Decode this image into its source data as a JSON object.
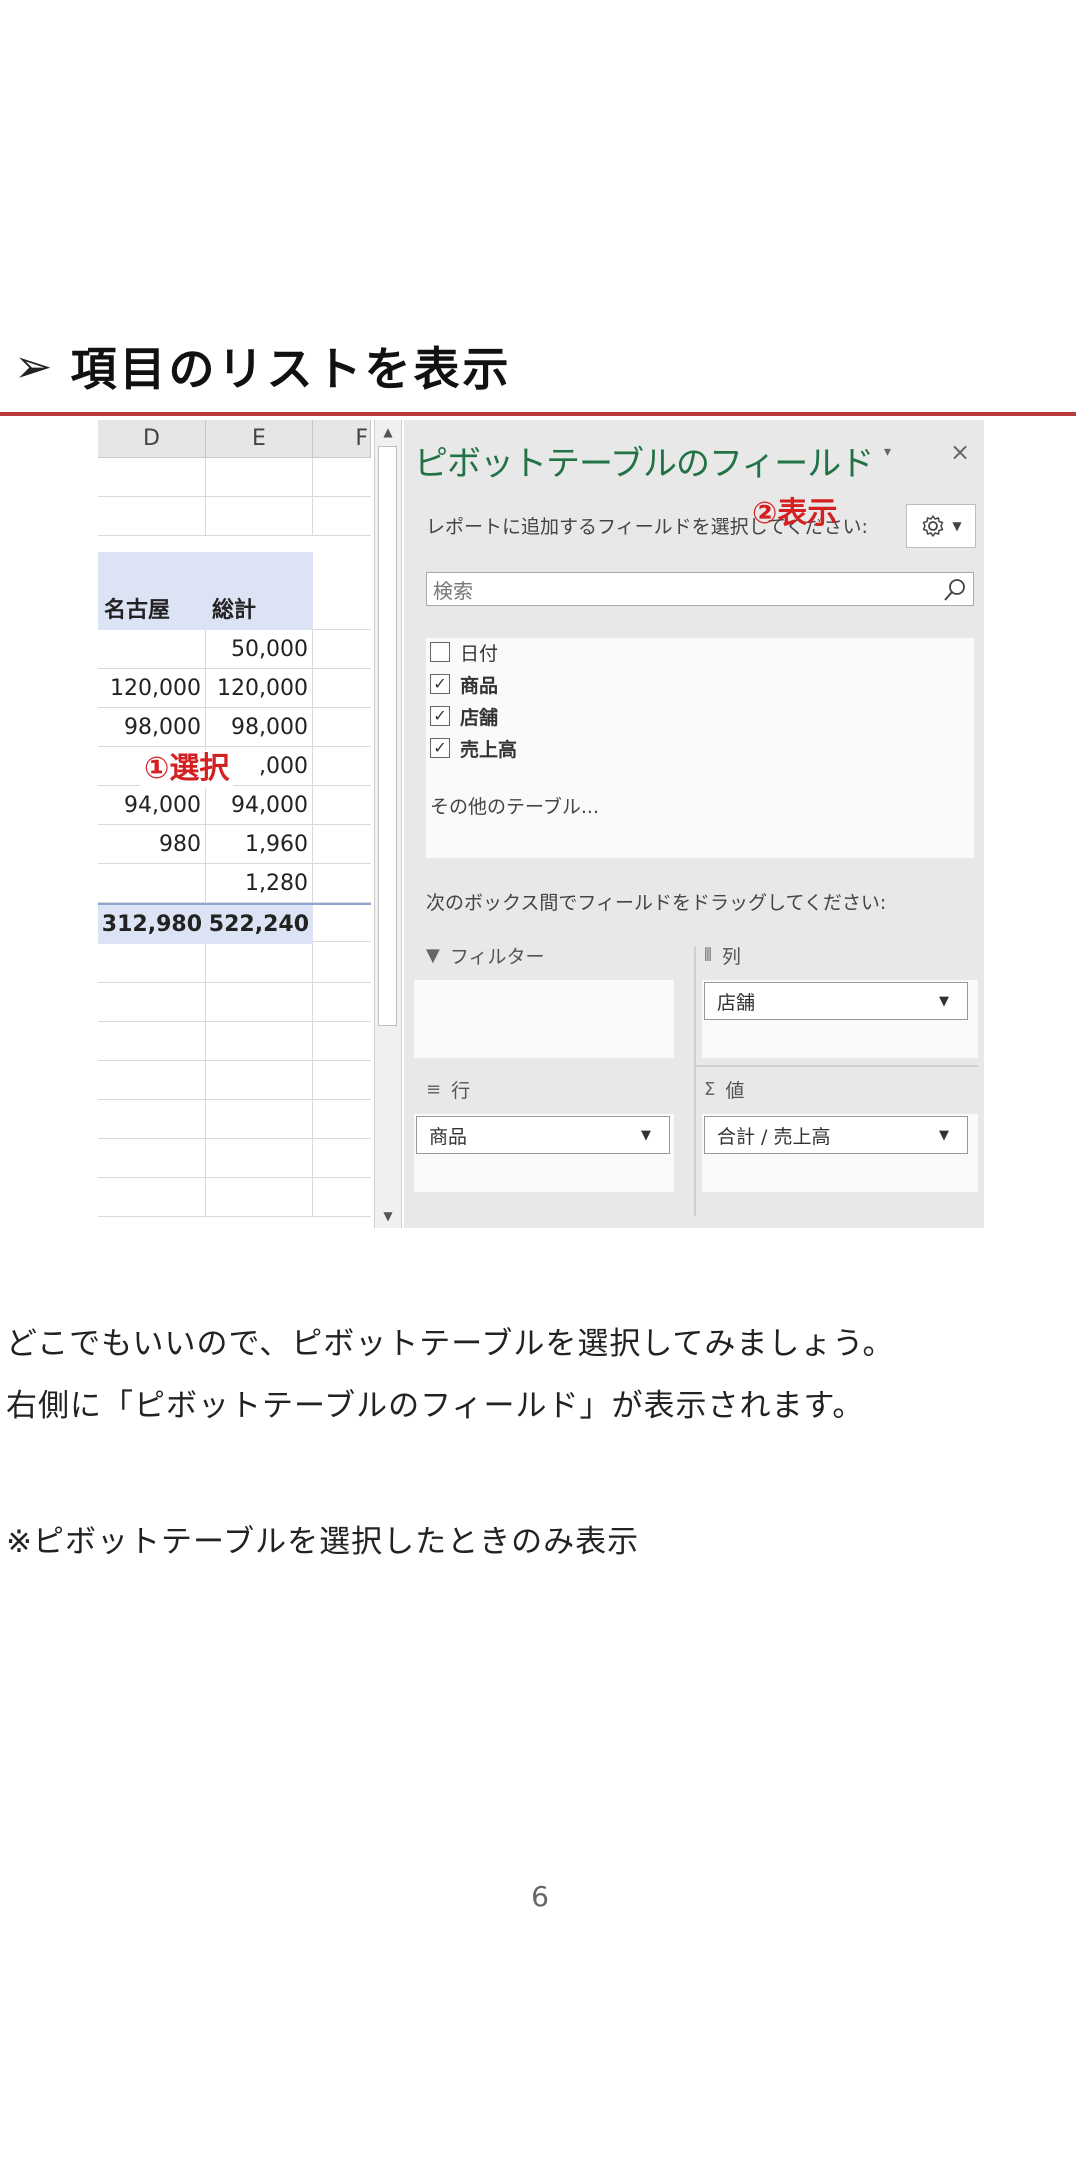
{
  "heading": {
    "arrow": "➢",
    "text": "項目のリストを表示"
  },
  "sheet": {
    "columns": [
      "D",
      "E",
      "F"
    ],
    "header": {
      "d": "名古屋",
      "e": "総計"
    },
    "rows": [
      {
        "d": "",
        "e": "50,000"
      },
      {
        "d": "120,000",
        "e": "120,000"
      },
      {
        "d": "98,000",
        "e": "98,000"
      },
      {
        "d": "",
        "e": ",000"
      },
      {
        "d": "94,000",
        "e": "94,000"
      },
      {
        "d": "980",
        "e": "1,960"
      },
      {
        "d": "",
        "e": "1,280"
      }
    ],
    "total": {
      "d": "312,980",
      "e": "522,240"
    },
    "select_annotation": "①選択"
  },
  "pane": {
    "title": "ピボットテーブルのフィールド",
    "dropdown_icon": "▾",
    "close_icon": "×",
    "subtitle": "レポートに追加するフィールドを選択してください:",
    "show_annotation": "②表示",
    "search_placeholder": "検索",
    "fields": [
      {
        "label": "日付",
        "checked": false
      },
      {
        "label": "商品",
        "checked": true
      },
      {
        "label": "店舗",
        "checked": true
      },
      {
        "label": "売上高",
        "checked": true
      }
    ],
    "more_tables": "その他のテーブル...",
    "drag_hint": "次のボックス間でフィールドをドラッグしてください:",
    "areas": {
      "filter": {
        "label": "フィルター",
        "icon": "▼"
      },
      "columns": {
        "label": "列",
        "icon": "⦀",
        "item": "店舗"
      },
      "rows": {
        "label": "行",
        "icon": "≡",
        "item": "商品"
      },
      "values": {
        "label": "値",
        "icon": "Σ",
        "item": "合計 / 売上高"
      }
    }
  },
  "body": {
    "line1": "どこでもいいので、ピボットテーブルを選択してみましょう。",
    "line2": "右側に「ピボットテーブルのフィールド」が表示されます。",
    "note": "※ピボットテーブルを選択したときのみ表示"
  },
  "page_number": "6",
  "colors": {
    "accent_rule": "#b73a3a",
    "annotation_red": "#d42020",
    "pane_title_green": "#217346",
    "pivot_band": "#dbe3f4"
  }
}
